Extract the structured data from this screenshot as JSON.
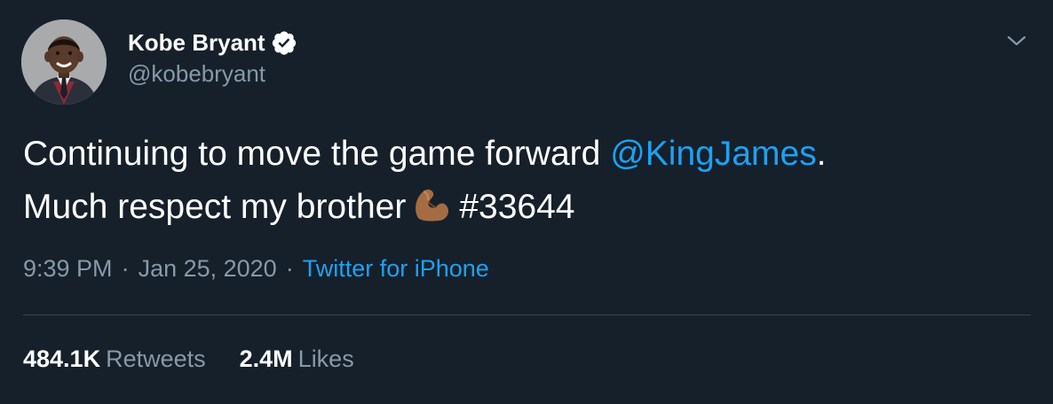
{
  "author": {
    "display_name": "Kobe Bryant",
    "handle": "@kobebryant",
    "verified": true
  },
  "tweet": {
    "line1_text": "Continuing to move the game forward ",
    "mention": "@KingJames",
    "line1_end": ".",
    "line2_text": "Much respect my brother",
    "emoji_icon": "flexed-biceps-icon",
    "hashtag": "#33644"
  },
  "meta": {
    "time": "9:39 PM",
    "separator": "·",
    "date": "Jan 25, 2020",
    "source": "Twitter for iPhone"
  },
  "stats": {
    "retweets_count": "484.1K",
    "retweets_label": "Retweets",
    "likes_count": "2.4M",
    "likes_label": "Likes"
  },
  "colors": {
    "background": "#15202b",
    "text": "#ffffff",
    "secondary": "#8899a6",
    "accent": "#1da1f2",
    "verified_badge": "#ffffff",
    "divider": "#38444d"
  }
}
